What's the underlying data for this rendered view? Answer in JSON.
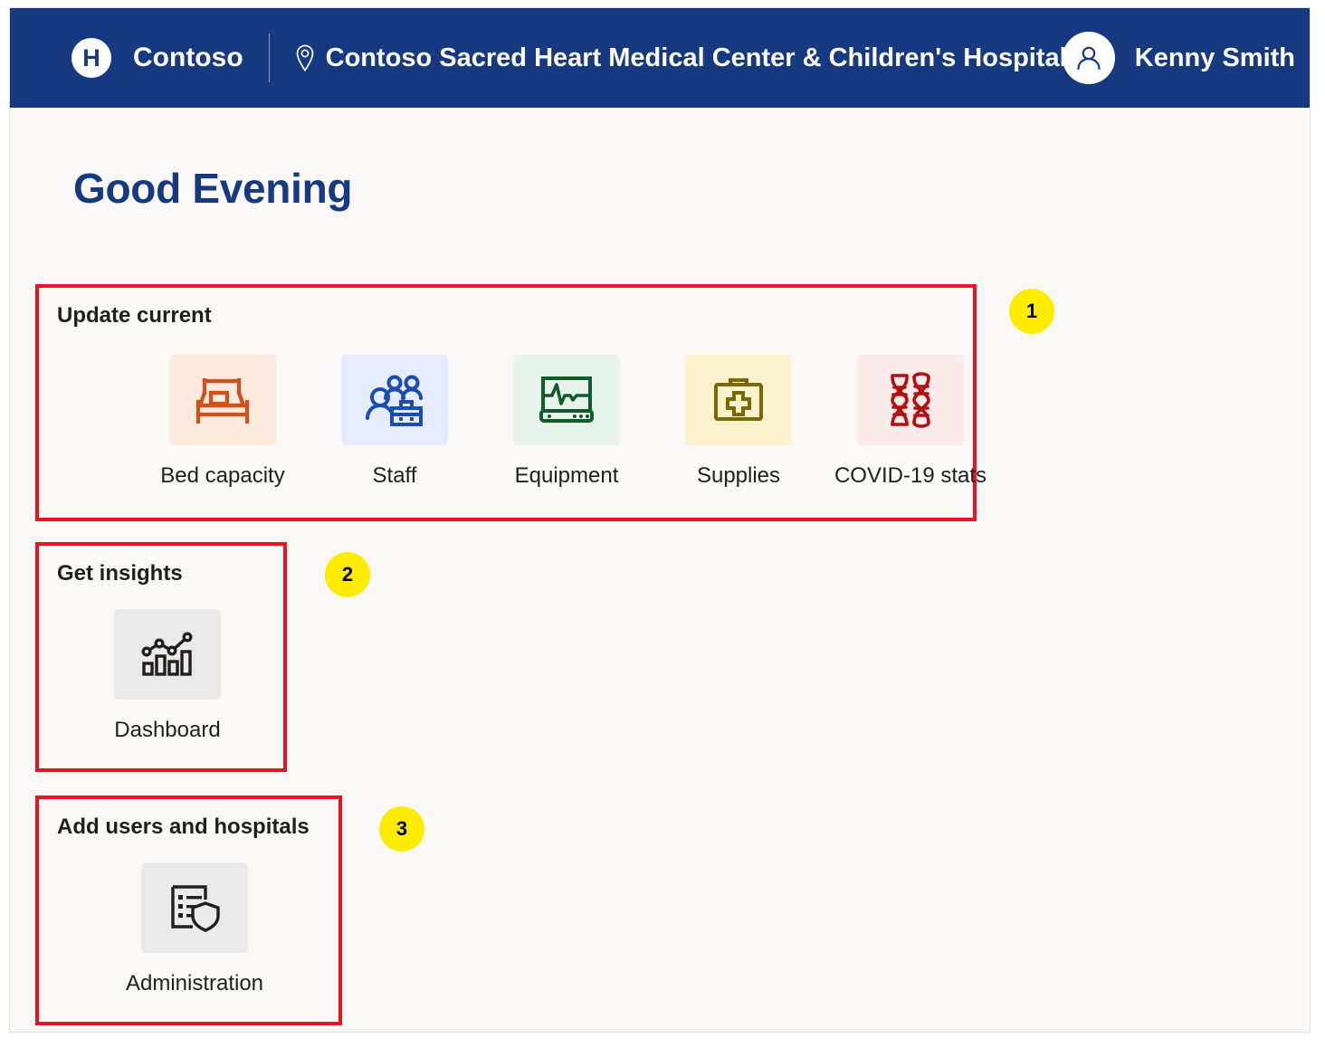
{
  "header": {
    "logo_letter": "H",
    "logo_icon": "hospital-logo-icon",
    "brand_name": "Contoso",
    "location_icon": "map-pin-icon",
    "site_name": "Contoso Sacred Heart Medical Center & Children's Hospital",
    "avatar_icon": "person-avatar-icon",
    "user_name": "Kenny Smith",
    "background_color": "#16397f"
  },
  "page": {
    "greeting": "Good Evening",
    "greeting_color": "#16397f",
    "background_color": "#faf9f8"
  },
  "callouts": [
    {
      "number": "1",
      "target": "Update current",
      "color": "#ffec00"
    },
    {
      "number": "2",
      "target": "Get insights",
      "color": "#ffec00"
    },
    {
      "number": "3",
      "target": "Add users and hospitals",
      "color": "#ffec00"
    }
  ],
  "highlight_color": "#ee1122",
  "sections": [
    {
      "title": "Update current",
      "tiles": [
        {
          "label": "Bed capacity",
          "icon": "bed-icon",
          "icon_color": "#d1511c",
          "tile_color": "#fdeade"
        },
        {
          "label": "Staff",
          "icon": "people-group-icon",
          "icon_color": "#1b4cb3",
          "tile_color": "#e6ecfd"
        },
        {
          "label": "Equipment",
          "icon": "monitor-vitals-icon",
          "icon_color": "#125c2b",
          "tile_color": "#e8f3ec"
        },
        {
          "label": "Supplies",
          "icon": "medical-kit-icon",
          "icon_color": "#7a6a06",
          "tile_color": "#fcf2cd"
        },
        {
          "label": "COVID-19 stats",
          "icon": "dna-icon",
          "icon_color": "#b31010",
          "tile_color": "#fbeaea"
        }
      ]
    },
    {
      "title": "Get insights",
      "tiles": [
        {
          "label": "Dashboard",
          "icon": "bar-chart-trend-icon",
          "icon_color": "#201f1e",
          "tile_color": "#ebeaea"
        }
      ]
    },
    {
      "title": "Add users and hospitals",
      "tiles": [
        {
          "label": "Administration",
          "icon": "admin-shield-list-icon",
          "icon_color": "#201f1e",
          "tile_color": "#ebeaea"
        }
      ]
    }
  ]
}
